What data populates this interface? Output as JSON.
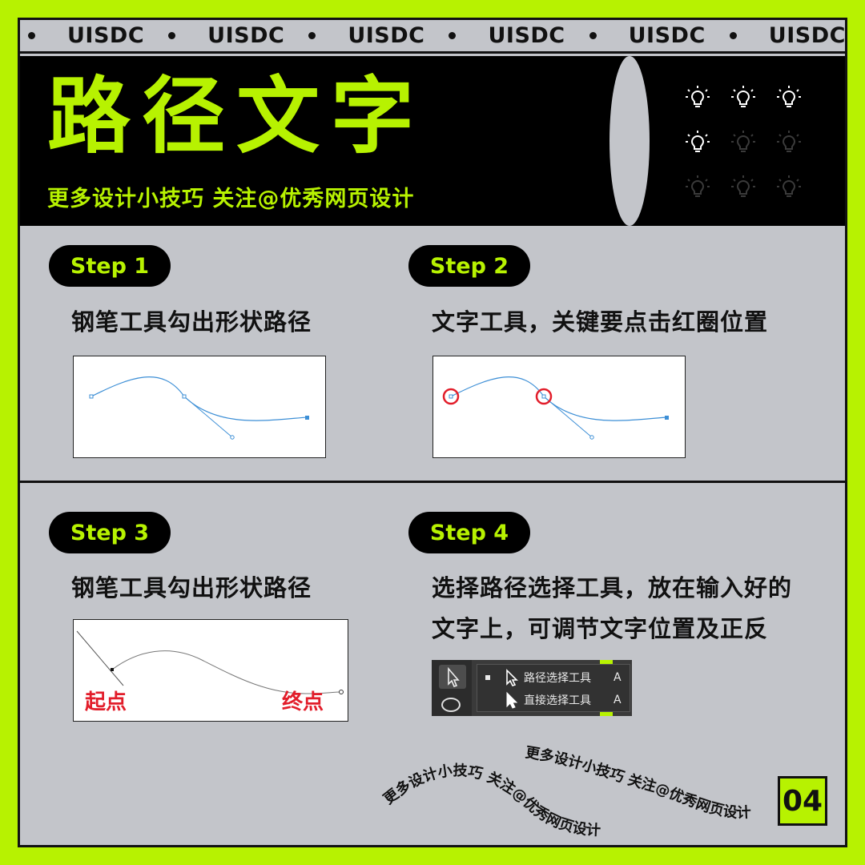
{
  "marquee": {
    "text": "UISDC"
  },
  "header": {
    "title": "路径文字",
    "subtitle": "更多设计小技巧 关注@优秀网页设计"
  },
  "steps": [
    {
      "label": "Step 1",
      "heading": "钢笔工具勾出形状路径"
    },
    {
      "label": "Step 2",
      "heading": "文字工具，关键要点击红圈位置"
    },
    {
      "label": "Step 3",
      "heading": "钢笔工具勾出形状路径",
      "start_label": "起点",
      "end_label": "终点"
    },
    {
      "label": "Step 4",
      "heading_line1": "选择路径选择工具，放在输入好的",
      "heading_line2": "文字上，可调节文字位置及正反"
    }
  ],
  "tool_menu": {
    "items": [
      {
        "label": "路径选择工具",
        "shortcut": "A"
      },
      {
        "label": "直接选择工具",
        "shortcut": "A"
      }
    ]
  },
  "path_text": {
    "upright": "更多设计小技巧 关注@优秀网页设计",
    "flipped": "更多设计小技巧 关注@优秀网页设计"
  },
  "page_number": "04",
  "colors": {
    "accent": "#b7f201",
    "panel": "#c3c5ca",
    "dark": "#000000",
    "red": "#e21d2a",
    "path_blue": "#3d8fd6"
  }
}
